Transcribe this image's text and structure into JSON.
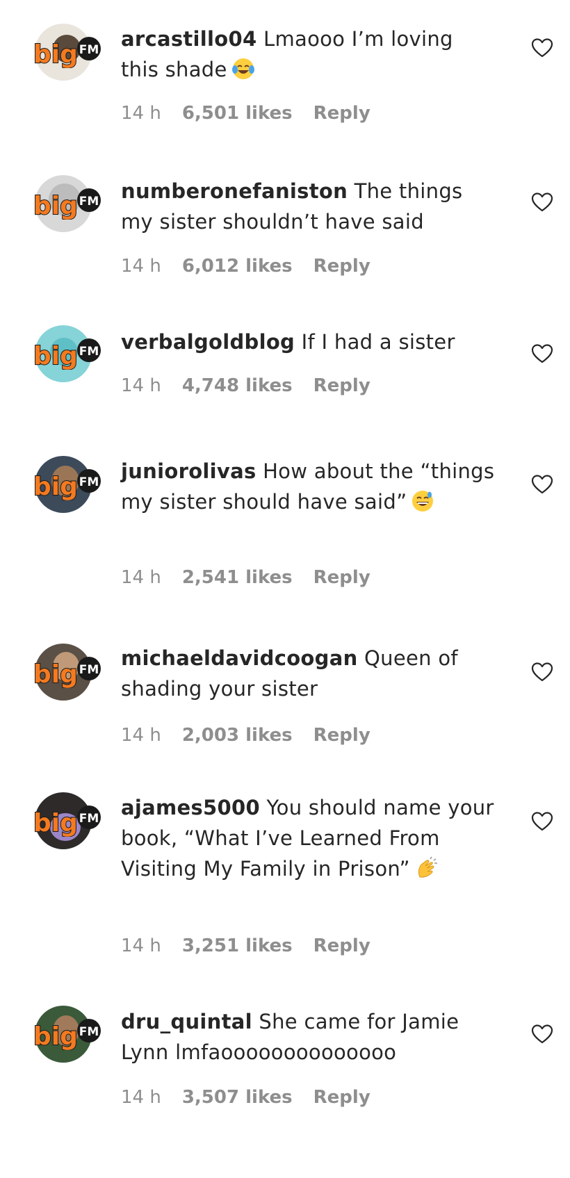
{
  "brand": {
    "badge_text_big": "big",
    "badge_text_fm": "FM",
    "badge_orange": "#f47a20"
  },
  "colors": {
    "meta": "#8e8e8e",
    "text": "#262626"
  },
  "comments": [
    {
      "username": "arcastillo04",
      "text": "Lmaooo I’m loving this shade",
      "emoji": "face-with-tears-of-joy",
      "time": "14 h",
      "likes": "6,501 likes",
      "reply": "Reply"
    },
    {
      "username": "numberonefaniston",
      "text": "The things my sister shouldn’t have said",
      "emoji": "",
      "time": "14 h",
      "likes": "6,012 likes",
      "reply": "Reply"
    },
    {
      "username": "verbalgoldblog",
      "text": "If I had a sister",
      "emoji": "",
      "time": "14 h",
      "likes": "4,748 likes",
      "reply": "Reply"
    },
    {
      "username": "juniorolivas",
      "text": "How about the “things my sister should have said”",
      "emoji": "grinning-face-with-sweat",
      "time": "14 h",
      "likes": "2,541 likes",
      "reply": "Reply"
    },
    {
      "username": "michaeldavidcoogan",
      "text": "Queen of shading your sister",
      "emoji": "",
      "time": "14 h",
      "likes": "2,003 likes",
      "reply": "Reply"
    },
    {
      "username": "ajames5000",
      "text": "You should name your book, “What I’ve Learned From Visiting My Family in Prison”",
      "emoji": "clapping-hands",
      "time": "14 h",
      "likes": "3,251 likes",
      "reply": "Reply"
    },
    {
      "username": "dru_quintal",
      "text": "She came for Jamie Lynn lmfaoooooooooooooo",
      "emoji": "",
      "time": "14 h",
      "likes": "3,507 likes",
      "reply": "Reply"
    }
  ]
}
